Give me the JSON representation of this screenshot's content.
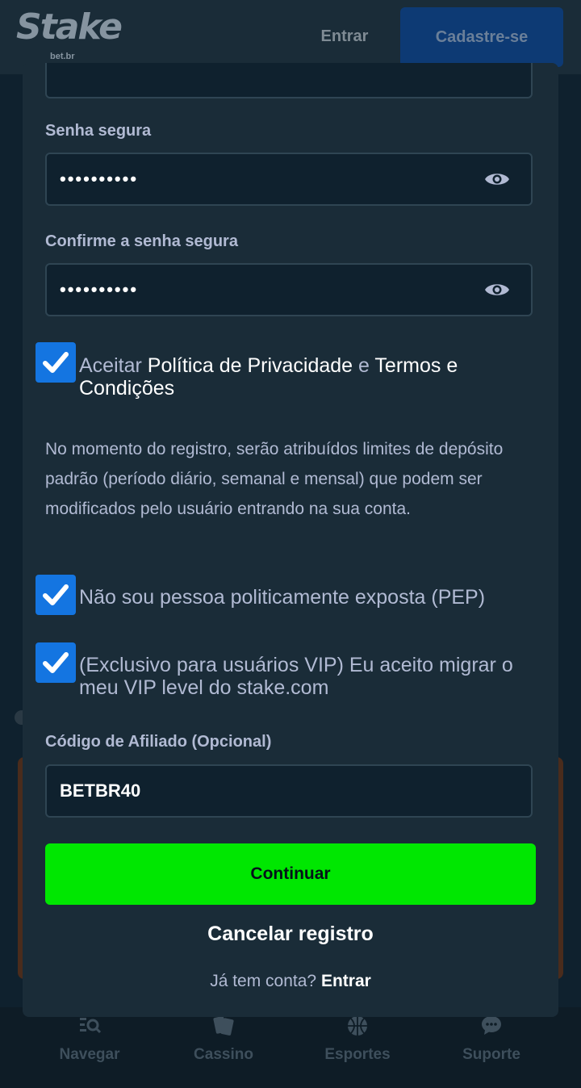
{
  "header": {
    "logo_text": "Stake",
    "logo_sub": "bet.br",
    "login_label": "Entrar",
    "signup_label": "Cadastre-se"
  },
  "bottom_nav": {
    "items": [
      {
        "label": "Navegar",
        "icon": "browse-search-icon"
      },
      {
        "label": "Cassino",
        "icon": "casino-cards-icon"
      },
      {
        "label": "Esportes",
        "icon": "sports-ball-icon"
      },
      {
        "label": "Suporte",
        "icon": "chat-bubble-icon"
      }
    ]
  },
  "form": {
    "password_label": "Senha segura",
    "password_value": "••••••••••",
    "confirm_label": "Confirme a senha segura",
    "confirm_value": "••••••••••",
    "terms": {
      "prefix": "Aceitar ",
      "privacy_link": "Política de Privacidade",
      "conj": " e ",
      "terms_link": "Termos e Condições",
      "checked": true
    },
    "deposit_info": "No momento do registro, serão atribuídos limites de depósito padrão (período diário, semanal e mensal) que podem ser modificados pelo usuário entrando na sua conta.",
    "pep_label": "Não sou pessoa politicamente exposta (PEP)",
    "pep_checked": true,
    "vip_label": "(Exclusivo para usuários VIP) Eu aceito migrar o meu VIP level do stake.com",
    "vip_checked": true,
    "affiliate_label": "Código de Afiliado (Opcional)",
    "affiliate_value": "BETBR40",
    "continue_label": "Continuar",
    "cancel_label": "Cancelar registro",
    "has_account_text": "Já tem conta?",
    "login_link": "Entrar"
  },
  "colors": {
    "background": "#0f212e",
    "panel": "#1a2c38",
    "accent_green": "#00e701",
    "checkbox_blue": "#1475e1"
  }
}
